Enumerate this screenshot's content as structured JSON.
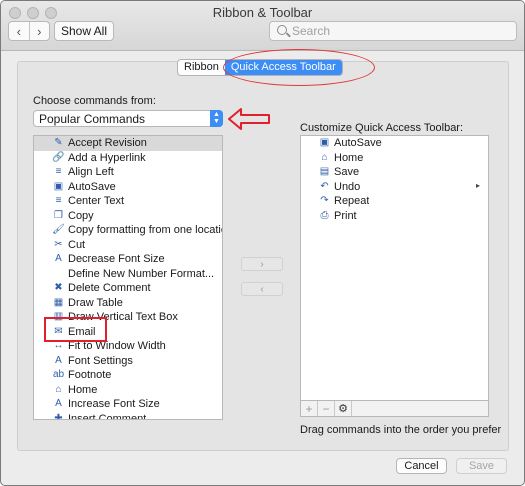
{
  "window": {
    "title": "Ribbon & Toolbar"
  },
  "toolbar": {
    "back": "‹",
    "forward": "›",
    "show_all_label": "Show All",
    "search_placeholder": "Search"
  },
  "segmented": {
    "tabs": [
      {
        "label": "Ribbon",
        "active": false
      },
      {
        "label": "Quick Access Toolbar",
        "active": true
      }
    ]
  },
  "choose_label": "Choose commands from:",
  "dropdown": {
    "selected": "Popular Commands"
  },
  "commands": [
    {
      "label": "Accept Revision",
      "icon": "accept-revision-icon",
      "selected": true
    },
    {
      "label": "Add a Hyperlink",
      "icon": "hyperlink-icon"
    },
    {
      "label": "Align Left",
      "icon": "align-left-icon"
    },
    {
      "label": "AutoSave",
      "icon": "autosave-icon"
    },
    {
      "label": "Center Text",
      "icon": "center-text-icon"
    },
    {
      "label": "Copy",
      "icon": "copy-icon"
    },
    {
      "label": "Copy formatting from one location...",
      "icon": "format-painter-icon"
    },
    {
      "label": "Cut",
      "icon": "scissors-icon"
    },
    {
      "label": "Decrease Font Size",
      "icon": "decrease-font-icon"
    },
    {
      "label": "Define New Number Format...",
      "icon": ""
    },
    {
      "label": "Delete Comment",
      "icon": "delete-comment-icon"
    },
    {
      "label": "Draw Table",
      "icon": "draw-table-icon"
    },
    {
      "label": "Draw Vertical Text Box",
      "icon": "vertical-text-box-icon"
    },
    {
      "label": "Email",
      "icon": "email-icon"
    },
    {
      "label": "Fit to Window Width",
      "icon": "fit-width-icon"
    },
    {
      "label": "Font Settings",
      "icon": "font-settings-icon"
    },
    {
      "label": "Footnote",
      "icon": "footnote-icon"
    },
    {
      "label": "Home",
      "icon": "home-icon"
    },
    {
      "label": "Increase Font Size",
      "icon": "increase-font-icon"
    },
    {
      "label": "Insert Comment",
      "icon": "insert-comment-icon"
    }
  ],
  "move": {
    "add": "›",
    "remove": "‹"
  },
  "qat_label": "Customize Quick Access Toolbar:",
  "qat_items": [
    {
      "label": "AutoSave",
      "icon": "autosave-icon"
    },
    {
      "label": "Home",
      "icon": "home-icon"
    },
    {
      "label": "Save",
      "icon": "save-icon"
    },
    {
      "label": "Undo",
      "icon": "undo-icon"
    },
    {
      "label": "Repeat",
      "icon": "repeat-icon"
    },
    {
      "label": "Print",
      "icon": "print-icon"
    }
  ],
  "qat_tools": {
    "add": "+",
    "remove": "−",
    "settings": "⚙"
  },
  "hint": "Drag commands into the order you prefer",
  "buttons": {
    "cancel": "Cancel",
    "save": "Save"
  },
  "colors": {
    "accent": "#3c8df6",
    "annotation": "#e21f2c"
  }
}
